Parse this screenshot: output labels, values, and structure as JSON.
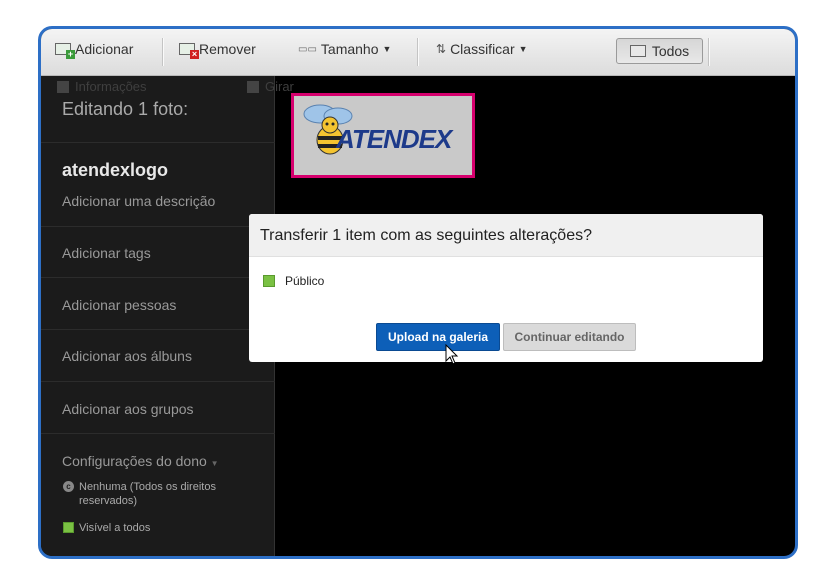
{
  "toolbar": {
    "add": "Adicionar",
    "remove": "Remover",
    "size": "Tamanho",
    "sort": "Classificar",
    "all": "Todos"
  },
  "sidebar": {
    "info": "Informações",
    "rotate": "Girar",
    "editing_title": "Editando 1 foto:",
    "photo_name": "atendexlogo",
    "add_description": "Adicionar uma descrição",
    "add_tags": "Adicionar tags",
    "add_people": "Adicionar pessoas",
    "add_albums": "Adicionar aos álbuns",
    "add_groups": "Adicionar aos grupos",
    "owner_settings": "Configurações do dono",
    "license": "Nenhuma (Todos os direitos reservados)",
    "license_line1": "Nenhuma (Todos os direitos",
    "license_line2": "reservados)",
    "visibility": "Visível a todos"
  },
  "photo": {
    "logo_text": "ATENDEX"
  },
  "dialog": {
    "title": "Transferir 1 item com as seguintes alterações?",
    "privacy": "Público",
    "upload_button": "Upload na galeria",
    "continue_button": "Continuar editando"
  },
  "colors": {
    "frame_border": "#2d6fc6",
    "primary_button": "#0d5fb8",
    "photo_border": "#d6006e",
    "public_green": "#7ac143"
  }
}
